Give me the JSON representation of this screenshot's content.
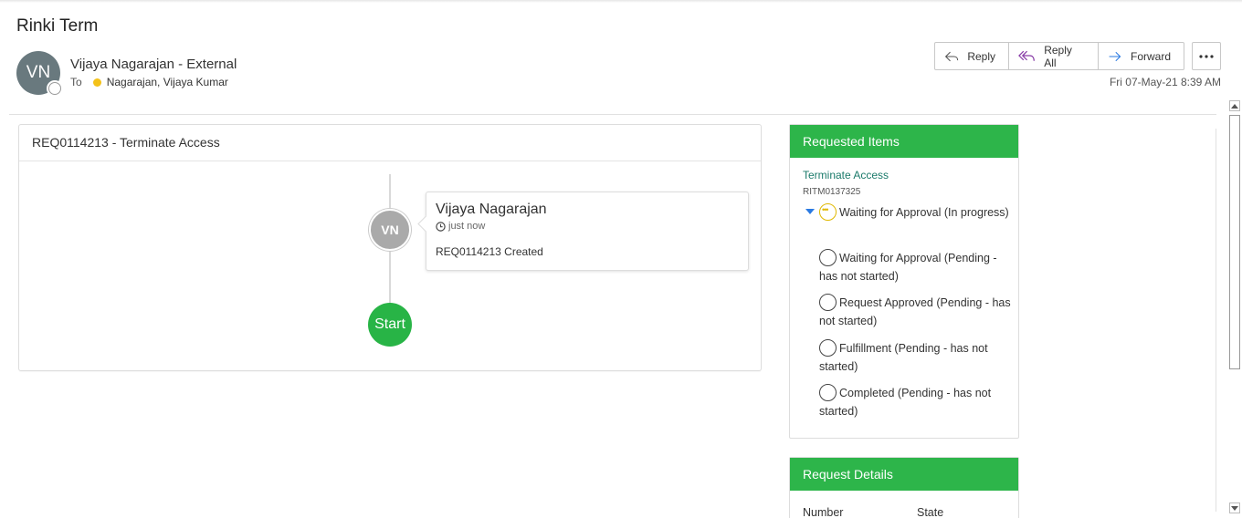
{
  "email": {
    "subject": "Rinki Term",
    "sender_initials": "VN",
    "sender_name": "Vijaya Nagarajan - External",
    "to_label": "To",
    "to_name": "Nagarajan, Vijaya Kumar",
    "date": "Fri 07-May-21 8:39 AM"
  },
  "actions": {
    "reply": "Reply",
    "reply_all": "Reply All",
    "forward": "Forward"
  },
  "timeline": {
    "title": "REQ0114213 - Terminate Access",
    "avatar_initials": "VN",
    "entry_name": "Vijaya Nagarajan",
    "entry_time": "just now",
    "entry_message": "REQ0114213 Created",
    "start_label": "Start"
  },
  "requested_items": {
    "header": "Requested Items",
    "item_link": "Terminate Access",
    "item_number": "RITM0137325",
    "steps": [
      {
        "label": "Waiting for Approval (In progress)",
        "status": "in-progress"
      },
      {
        "label": "Waiting for Approval (Pending - has not started)",
        "status": "pending"
      },
      {
        "label": "Request Approved (Pending - has not started)",
        "status": "pending"
      },
      {
        "label": "Fulfillment (Pending - has not started)",
        "status": "pending"
      },
      {
        "label": "Completed (Pending - has not started)",
        "status": "pending"
      }
    ]
  },
  "request_details": {
    "header": "Request Details",
    "col1": "Number",
    "col2": "State"
  },
  "colors": {
    "green": "#2db54a",
    "link": "#1a7a6a",
    "avatar": "#69797e"
  }
}
